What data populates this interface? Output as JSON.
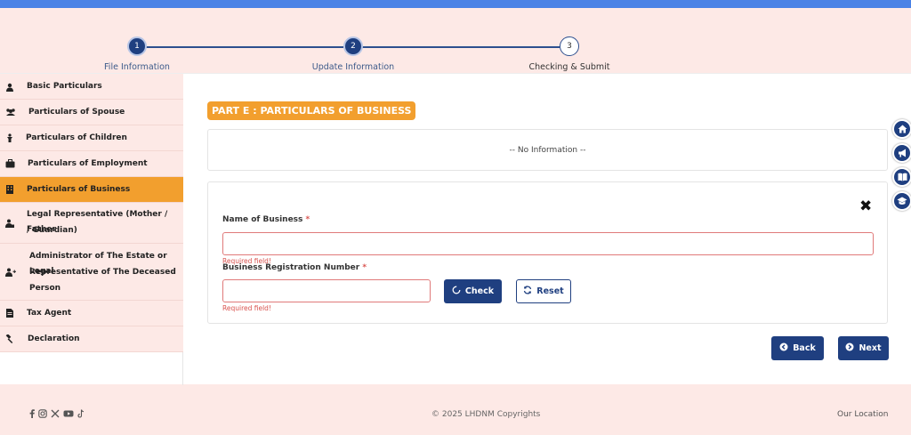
{
  "stepper": {
    "steps": [
      {
        "number": "1",
        "label": "File Information"
      },
      {
        "number": "2",
        "label": "Update Information"
      },
      {
        "number": "3",
        "label": "Checking & Submit"
      }
    ]
  },
  "sidebar": {
    "items": [
      {
        "label": "Basic Particulars",
        "icon": "person-icon"
      },
      {
        "label": "Particulars of Spouse",
        "icon": "users-icon"
      },
      {
        "label": "Particulars of Children",
        "icon": "child-icon"
      },
      {
        "label": "Particulars of Employment",
        "icon": "briefcase-icon"
      },
      {
        "label": "Particulars of Business",
        "icon": "building-icon"
      },
      {
        "label": "Legal Representative (Mother / Father / Guardian)",
        "line1": "Legal Representative (Mother / Father",
        "line2": "/ Guardian)",
        "icon": "user-lock-icon"
      },
      {
        "label": "Administrator of The Estate or Legal Representative of The Deceased Person",
        "line1": "Administrator of The Estate or Legal",
        "line2": "Representative of The Deceased",
        "line3": "Person",
        "icon": "user-plus-icon"
      },
      {
        "label": "Tax Agent",
        "icon": "file-icon"
      },
      {
        "label": "Declaration",
        "icon": "gavel-icon"
      }
    ],
    "active_index": 4
  },
  "content": {
    "part_title": "PART E : PARTICULARS OF BUSINESS",
    "no_info_text": "-- No Information --",
    "form": {
      "name_label": "Name of Business",
      "name_value": "",
      "reg_label": "Business Registration Number",
      "reg_value": "",
      "required_star": "*",
      "error_text": "Required field!",
      "check_label": "Check",
      "reset_label": "Reset"
    },
    "back_label": "Back",
    "next_label": "Next"
  },
  "float_icons": [
    "home-icon",
    "megaphone-icon",
    "book-icon",
    "graduation-cap-icon"
  ],
  "footer": {
    "social_icons": [
      "facebook-icon",
      "instagram-icon",
      "x-icon",
      "youtube-icon",
      "tiktok-icon"
    ],
    "copyright": "© 2025 LHDNM Copyrights",
    "location_link": "Our Location"
  },
  "colors": {
    "primary": "#1f3f80",
    "accent": "#f29f2e",
    "page_bg": "#fde9e6",
    "top_bar": "#4a82e6",
    "error": "#d9534f"
  }
}
